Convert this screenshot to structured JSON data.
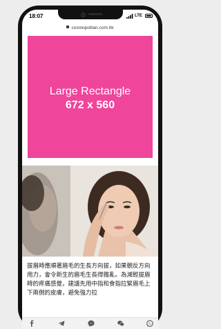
{
  "status_bar": {
    "time": "18:07",
    "network": "LTE"
  },
  "browser": {
    "url": "cosmopolitan.com.hk"
  },
  "ad": {
    "line1": "Large Rectangle",
    "line2": "672 x 560"
  },
  "article": {
    "text": "拔眉時應順著眉毛的生長方向拔，如果朝反方向用力，會令新生的眉毛生長得雜亂。為減輕拔眉時的疼痛感覺，建議先用中指和食指拉緊眉毛上下兩側的皮膚，避免強力拉"
  },
  "share_bar": {
    "icons": [
      "facebook-icon",
      "telegram-icon",
      "messenger-icon",
      "wechat-icon",
      "whatsapp-icon"
    ]
  }
}
